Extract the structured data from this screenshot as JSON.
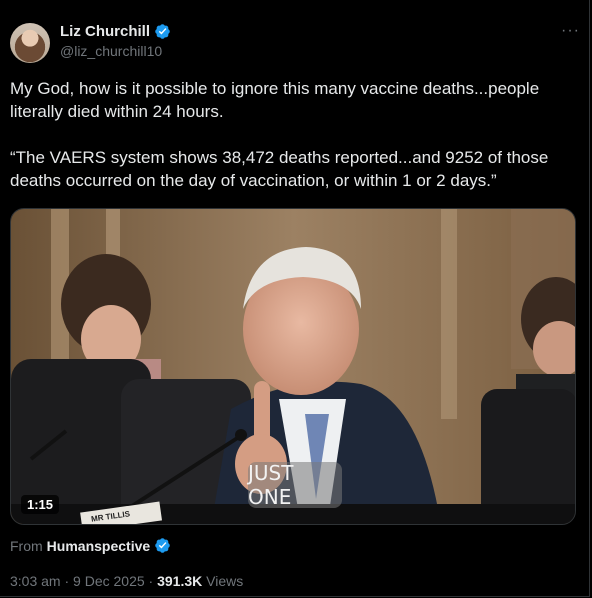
{
  "author": {
    "name": "Liz Churchill",
    "handle": "@liz_churchill10",
    "verified": true,
    "verified_color": "#1d9bf0"
  },
  "more_icon": "more-icon",
  "more_label": "···",
  "tweet_text": "My God, how is it possible to ignore this many vaccine deaths...people literally died within 24 hours.\n\n“The VAERS system shows 38,472 deaths reported...and 9252 of those deaths occurred on the day of vaccination, or within 1 or 2 days.”",
  "media": {
    "duration": "1:15",
    "caption": "JUST ONE",
    "nameplate": "MR TILLIS"
  },
  "source": {
    "prefix": "From",
    "name": "Humanspective",
    "verified": true
  },
  "meta": {
    "time": "3:03 am",
    "separator": "·",
    "date": "9 Dec 2025",
    "views_count": "391.3K",
    "views_label": "Views"
  },
  "colors": {
    "background": "#000000",
    "text": "#e7e9ea",
    "secondary": "#71767b",
    "accent": "#1d9bf0"
  }
}
